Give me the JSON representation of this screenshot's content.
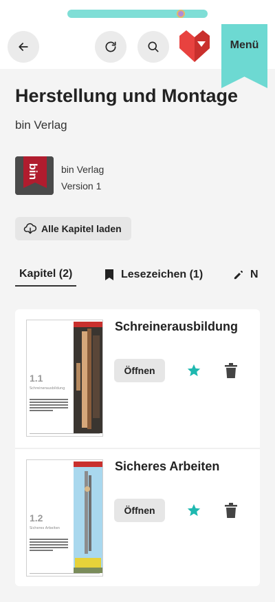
{
  "header": {
    "reading_progress": 0.83,
    "back_icon": "arrow-left-icon",
    "reload_icon": "reload-icon",
    "search_icon": "search-icon",
    "menu_label": "Menü",
    "accent_color": "#6dd9d2",
    "brand_color": "#e8423f"
  },
  "book": {
    "title": "Herstellung und Montage",
    "publisher": "bin Verlag",
    "publisher_name": "bin Verlag",
    "version": "Version 1",
    "load_all_label": "Alle Kapitel laden",
    "load_all_icon": "cloud-download-icon"
  },
  "tabs": [
    {
      "label": "Kapitel (2)",
      "icon": ""
    },
    {
      "label": "Lesezeichen (1)",
      "icon": "bookmark-icon"
    },
    {
      "label": "N",
      "icon": "pencil-icon"
    }
  ],
  "chapters": [
    {
      "title": "Schreinerausbildung",
      "thumb_number": "1.1",
      "thumb_subtitle": "Schreinerausbildung",
      "open_label": "Öffnen",
      "favorite": true
    },
    {
      "title": "Sicheres Arbeiten",
      "thumb_number": "1.2",
      "thumb_subtitle": "Sicheres Arbeiten",
      "open_label": "Öffnen",
      "favorite": true
    }
  ]
}
